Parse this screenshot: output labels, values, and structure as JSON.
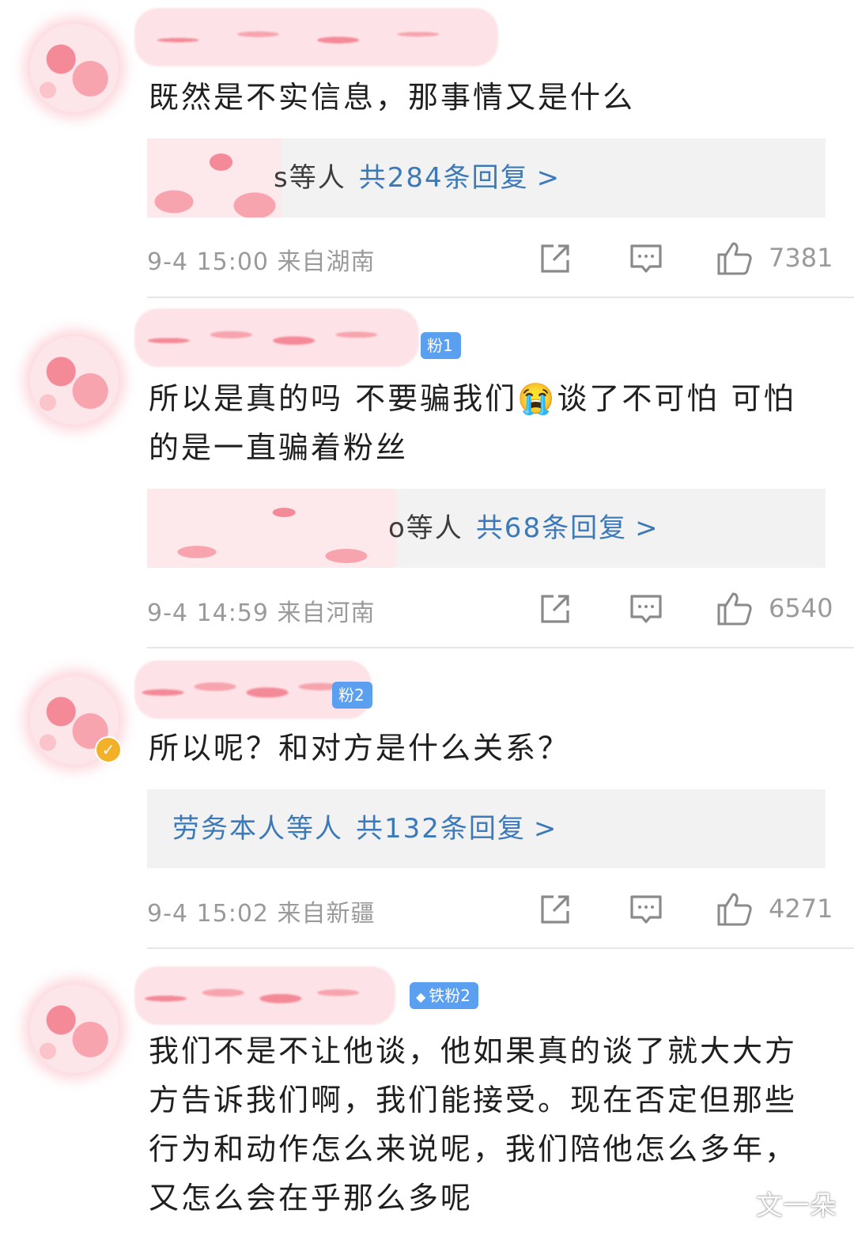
{
  "comments": [
    {
      "text": "既然是不实信息，那事情又是什么",
      "replies_by": "s等人",
      "replies_count": "共284条回复",
      "chevron": ">",
      "meta": "9-4 15:00  来自湖南",
      "likes": "7381"
    },
    {
      "badge": "粉1",
      "text": "所以是真的吗 不要骗我们😭谈了不可怕 可怕的是一直骗着粉丝",
      "replies_by": "o等人",
      "replies_count": "共68条回复",
      "chevron": ">",
      "meta": "9-4 14:59  来自河南",
      "likes": "6540"
    },
    {
      "badge": "粉2",
      "text": "所以呢？和对方是什么关系？",
      "replies_by": "劳务本人等人",
      "replies_count": "共132条回复",
      "chevron": ">",
      "meta": "9-4 15:02  来自新疆",
      "likes": "4271"
    },
    {
      "badge": "铁粉2",
      "text": "我们不是不让他谈，他如果真的谈了就大大方方告诉我们啊，我们能接受。现在否定但那些行为和动作怎么来说呢，我们陪他怎么多年，又怎么会在乎那么多呢"
    }
  ],
  "watermark": "文一朵",
  "colors": {
    "link": "#3c79b8",
    "badge": "#5b9ff0",
    "reply_bg": "#f2f2f2",
    "meta": "#9a9a9a"
  },
  "icons": [
    "share-icon",
    "comment-icon",
    "like-icon"
  ]
}
